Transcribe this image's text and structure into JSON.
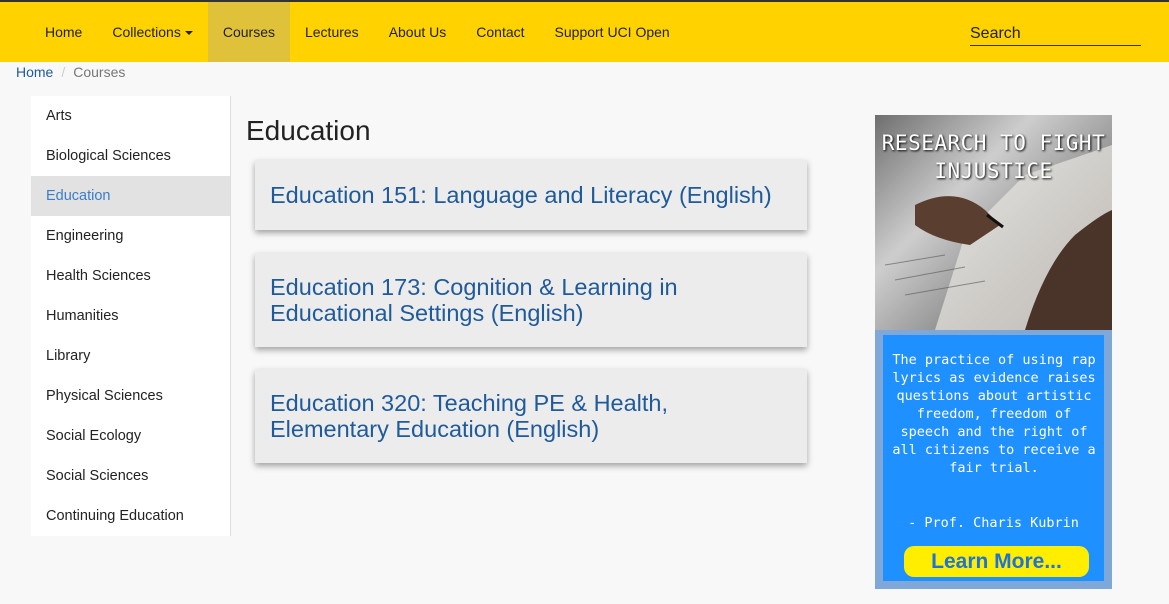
{
  "nav": {
    "items": [
      {
        "label": "Home"
      },
      {
        "label": "Collections"
      },
      {
        "label": "Courses"
      },
      {
        "label": "Lectures"
      },
      {
        "label": "About Us"
      },
      {
        "label": "Contact"
      },
      {
        "label": "Support UCI Open"
      }
    ],
    "active": "Courses",
    "search_placeholder": "Search"
  },
  "breadcrumb": {
    "home": "Home",
    "separator": "/",
    "current": "Courses"
  },
  "sidebar": {
    "items": [
      {
        "label": "Arts"
      },
      {
        "label": "Biological Sciences"
      },
      {
        "label": "Education"
      },
      {
        "label": "Engineering"
      },
      {
        "label": "Health Sciences"
      },
      {
        "label": "Humanities"
      },
      {
        "label": "Library"
      },
      {
        "label": "Physical Sciences"
      },
      {
        "label": "Social Ecology"
      },
      {
        "label": "Social Sciences"
      },
      {
        "label": "Continuing Education"
      }
    ],
    "active": "Education"
  },
  "main": {
    "title": "Education",
    "courses": [
      {
        "title": "Education 151: Language and Literacy (English)"
      },
      {
        "title": "Education 173: Cognition & Learning in Educational Settings (English)"
      },
      {
        "title": "Education 320: Teaching PE & Health, Elementary Education (English)"
      }
    ]
  },
  "ad": {
    "headline": "RESEARCH TO FIGHT INJUSTICE",
    "quote": "The practice of using rap lyrics as evidence raises questions about artistic freedom, freedom of speech and the right of all citizens to receive a fair trial.",
    "author": "- Prof. Charis Kubrin",
    "button": "Learn More..."
  },
  "colors": {
    "topbar": "#ffd200",
    "link": "#1f5a99",
    "active_side_text": "#3a7ec8",
    "ad_blue": "#1e90ff",
    "ad_button": "#ffee00"
  }
}
